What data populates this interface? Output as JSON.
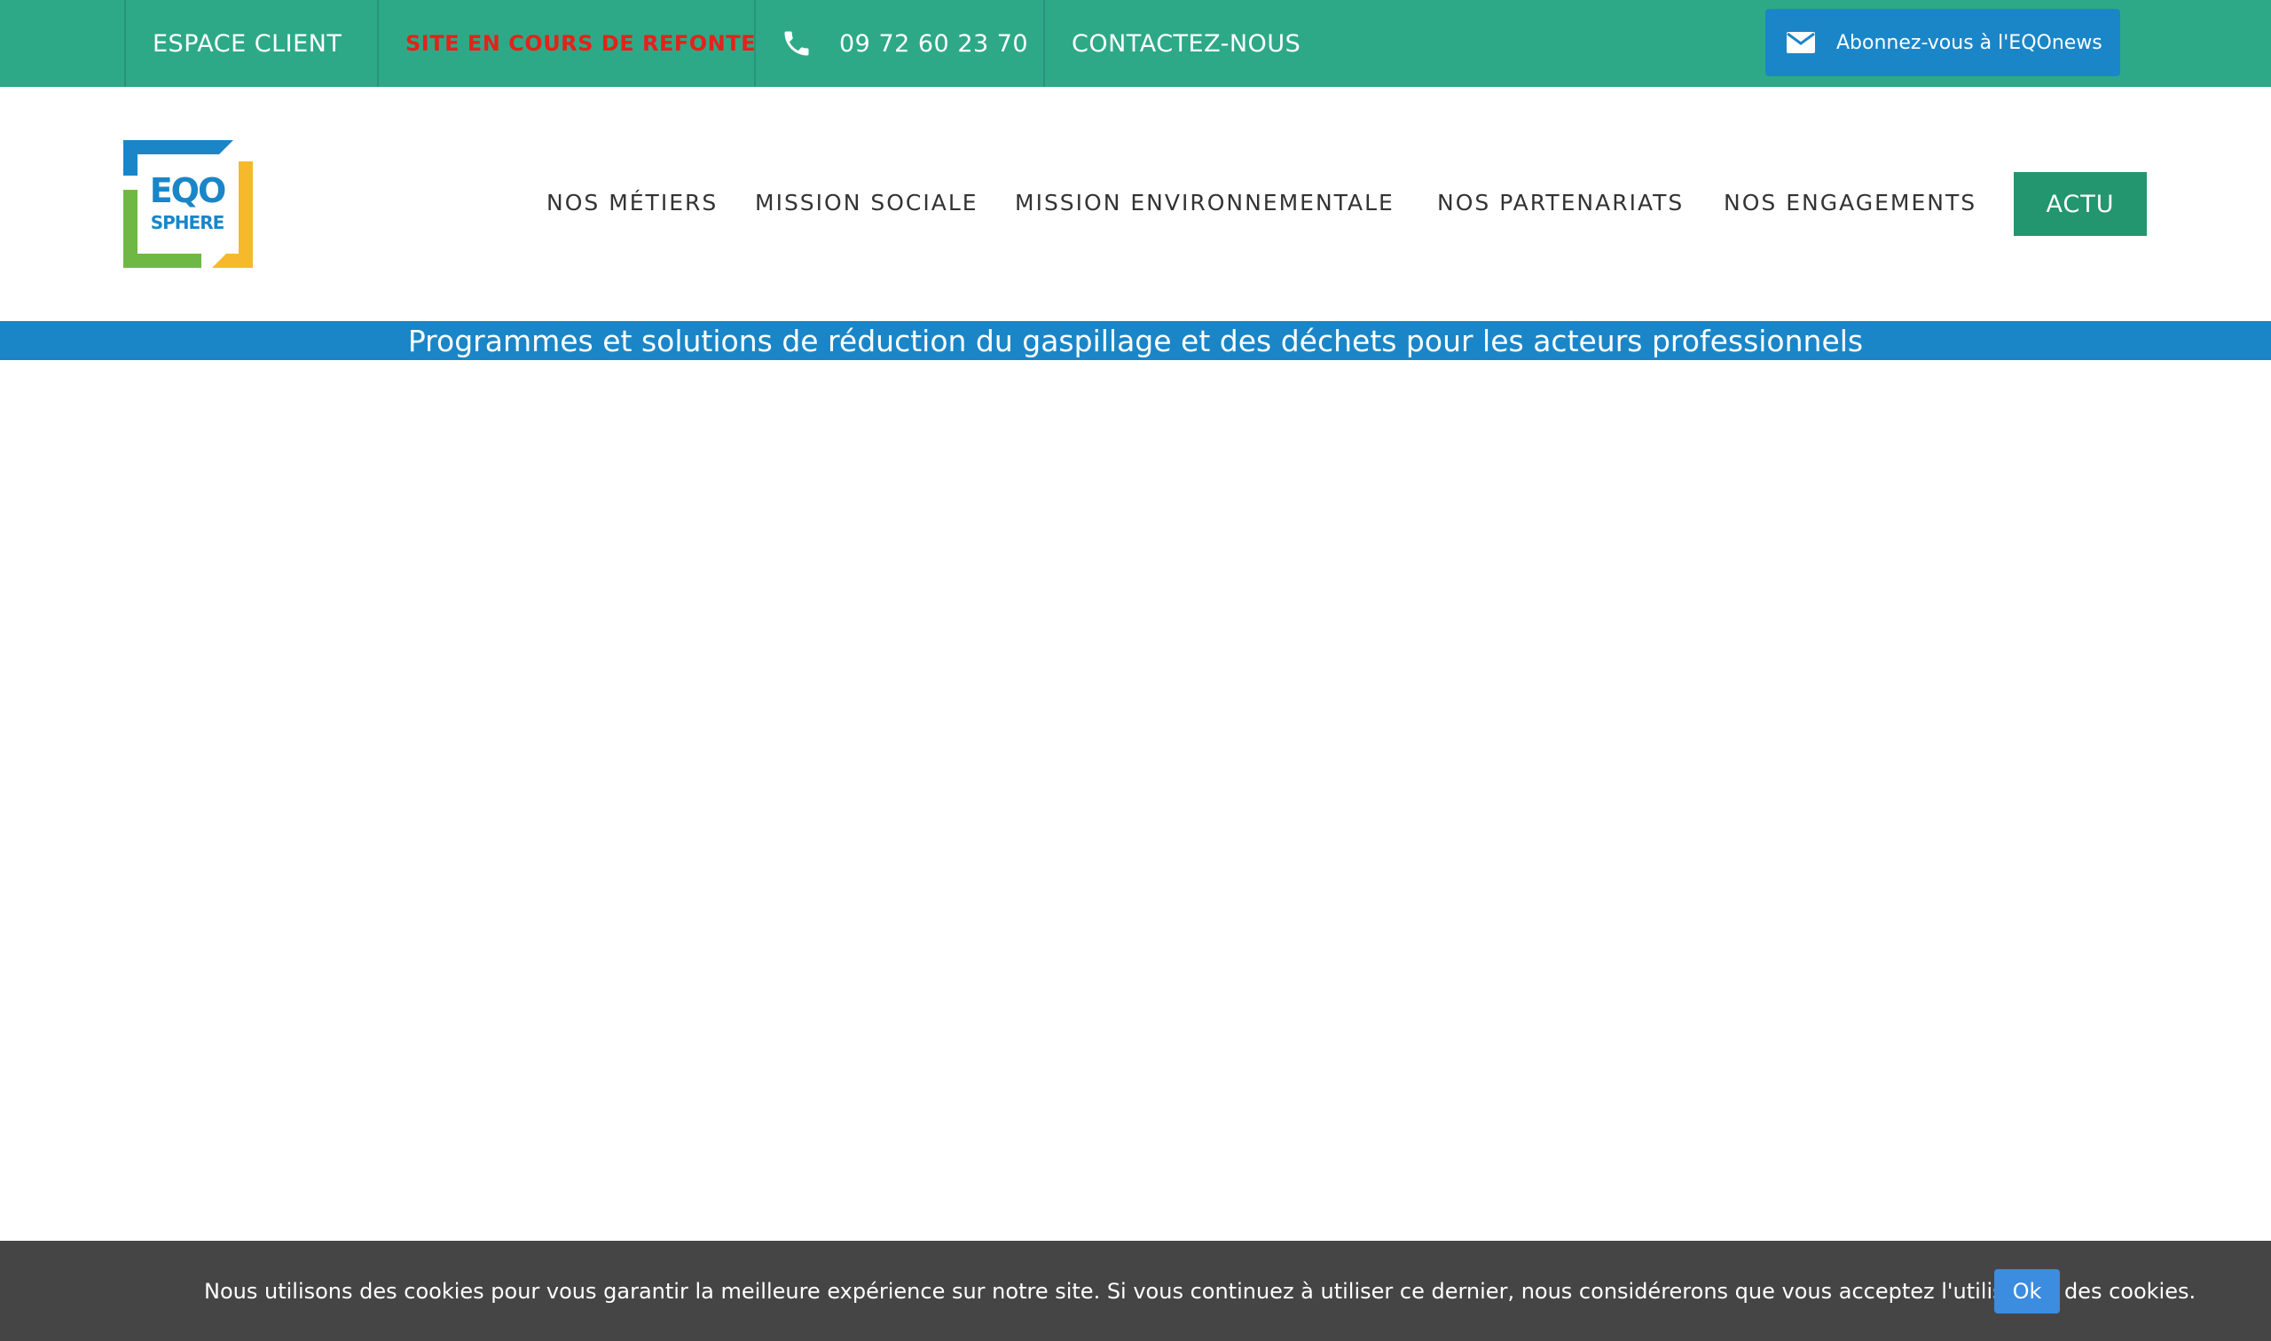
{
  "topbar": {
    "espace_client": "ESPACE CLIENT",
    "refonte": "SITE EN COURS DE REFONTE",
    "phone": "09 72 60 23 70",
    "contact": "CONTACTEZ-NOUS",
    "newsletter": "Abonnez-vous à l'EQOnews"
  },
  "logo": {
    "line1": "EQO",
    "line2": "SPHERE"
  },
  "nav": {
    "items": [
      {
        "label": "NOS MÉTIERS"
      },
      {
        "label": "MISSION SOCIALE"
      },
      {
        "label": "MISSION ENVIRONNEMENTALE"
      },
      {
        "label": "NOS PARTENARIATS"
      },
      {
        "label": "NOS ENGAGEMENTS"
      }
    ],
    "actu": "ACTU"
  },
  "tagline": "Programmes et solutions de réduction du gaspillage et des déchets pour les acteurs professionnels",
  "cookie": {
    "text": "Nous utilisons des cookies pour vous garantir la meilleure expérience sur notre site. Si vous continuez à utiliser ce dernier, nous considérerons que vous acceptez l'utilisation des cookies.",
    "ok": "Ok"
  },
  "colors": {
    "topbar": "#2ea988",
    "accent_blue": "#1a86c8",
    "actu_green": "#24966f",
    "refonte_red": "#e2231a",
    "cookie_bg": "#454545"
  },
  "icons": {
    "phone": "phone-icon",
    "mail": "envelope-icon"
  }
}
